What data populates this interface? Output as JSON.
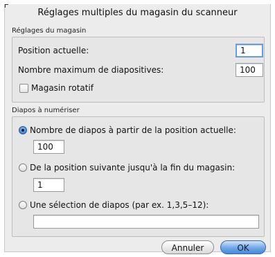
{
  "dialog": {
    "title": "Réglages multiples du magasin du scanneur"
  },
  "magazine_settings": {
    "group_label": "Réglages du magasin",
    "current_position_label": "Position actuelle:",
    "current_position_value": "1",
    "max_slides_label": "Nombre maximum de diapositives:",
    "max_slides_value": "100",
    "rotary_label": "Magasin rotatif",
    "rotary_checked": false
  },
  "slides_to_scan": {
    "group_label": "Diapos à numériser",
    "options": [
      {
        "label": "Nombre de diapos à partir de la position actuelle:",
        "value": "100",
        "selected": true
      },
      {
        "label": "De la position suivante jusqu'à la fin du magasin:",
        "value": "1",
        "selected": false
      },
      {
        "label": "Une sélection de diapos (par ex. 1,3,5–12):",
        "value": "",
        "selected": false
      }
    ]
  },
  "buttons": {
    "cancel_label": "Annuler",
    "ok_label": "OK"
  },
  "colors": {
    "accent": "#4a87d7",
    "focus_ring": "#6d9bd3",
    "background": "#ececec"
  }
}
